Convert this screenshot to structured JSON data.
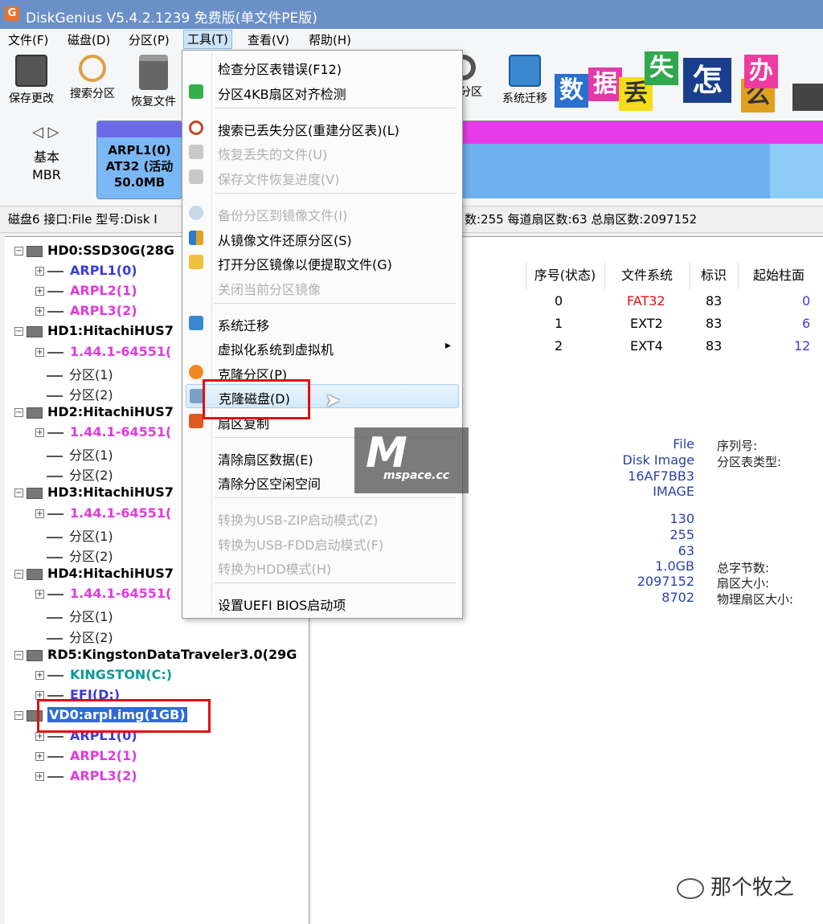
{
  "window": {
    "title": "DiskGenius V5.4.2.1239 免费版(单文件PE版)",
    "icon_text": "G"
  },
  "menubar": [
    {
      "label": "文件(F)"
    },
    {
      "label": "磁盘(D)"
    },
    {
      "label": "分区(P)"
    },
    {
      "label": "工具(T)"
    },
    {
      "label": "查看(V)"
    },
    {
      "label": "帮助(H)"
    }
  ],
  "toolbar": [
    {
      "label": "保存更改",
      "icon": "save-icon"
    },
    {
      "label": "搜索分区",
      "icon": "search-icon"
    },
    {
      "label": "恢复文件",
      "icon": "recover-icon"
    },
    {
      "label": "分区",
      "icon": "partition-icon"
    },
    {
      "label": "系统迁移",
      "icon": "migrate-icon"
    }
  ],
  "banner": {
    "chars": [
      "数",
      "据",
      "丢",
      "失",
      "怎",
      "么",
      "办"
    ]
  },
  "disk_strip": {
    "nav": "◁ ▷",
    "type_line1": "基本",
    "type_line2": "MBR",
    "part1_name": "ARPL1(0)",
    "part1_fs": "AT32 (活动 ",
    "part1_size": "50.0MB"
  },
  "info_line": {
    "left": "磁盘6 接口:File  型号:Disk I",
    "right": "数:255  每道扇区数:63  总扇区数:2097152"
  },
  "tree": [
    {
      "label": "HD0:SSD30G(28G",
      "kind": "disk"
    },
    {
      "label": "ARPL1(0)",
      "kind": "part",
      "color": "blue"
    },
    {
      "label": "ARPL2(1)",
      "kind": "part",
      "color": "pink"
    },
    {
      "label": "ARPL3(2)",
      "kind": "part",
      "color": "pink"
    },
    {
      "label": "HD1:HitachiHUS7",
      "kind": "disk"
    },
    {
      "label": "1.44.1-64551(",
      "kind": "part",
      "color": "pink"
    },
    {
      "label": "分区(1)",
      "kind": "sub"
    },
    {
      "label": "分区(2)",
      "kind": "sub"
    },
    {
      "label": "HD2:HitachiHUS7",
      "kind": "disk"
    },
    {
      "label": "1.44.1-64551(",
      "kind": "part",
      "color": "pink"
    },
    {
      "label": "分区(1)",
      "kind": "sub"
    },
    {
      "label": "分区(2)",
      "kind": "sub"
    },
    {
      "label": "HD3:HitachiHUS7",
      "kind": "disk"
    },
    {
      "label": "1.44.1-64551(",
      "kind": "part",
      "color": "pink"
    },
    {
      "label": "分区(1)",
      "kind": "sub"
    },
    {
      "label": "分区(2)",
      "kind": "sub"
    },
    {
      "label": "HD4:HitachiHUS7",
      "kind": "disk"
    },
    {
      "label": "1.44.1-64551(",
      "kind": "part",
      "color": "pink"
    },
    {
      "label": "分区(1)",
      "kind": "sub"
    },
    {
      "label": "分区(2)",
      "kind": "sub"
    },
    {
      "label": "RD5:KingstonDataTraveler3.0(29G",
      "kind": "disk"
    },
    {
      "label": "KINGSTON(C:)",
      "kind": "part",
      "color": "teal"
    },
    {
      "label": "EFI(D:)",
      "kind": "part",
      "color": "blue"
    },
    {
      "label": "VD0:arpl.img(1GB)",
      "kind": "disk-selected"
    },
    {
      "label": "ARPL1(0)",
      "kind": "part",
      "color": "blue"
    },
    {
      "label": "ARPL2(1)",
      "kind": "part",
      "color": "pink"
    },
    {
      "label": "ARPL3(2)",
      "kind": "part",
      "color": "pink"
    }
  ],
  "table": {
    "headers": [
      "序号(状态)",
      "文件系统",
      "标识",
      "起始柱面"
    ],
    "rows": [
      {
        "index": "0",
        "fs": "FAT32",
        "id": "83",
        "cyl": "0"
      },
      {
        "index": "1",
        "fs": "EXT2",
        "id": "83",
        "cyl": "6"
      },
      {
        "index": "2",
        "fs": "EXT4",
        "id": "83",
        "cyl": "12"
      }
    ]
  },
  "disk_info": {
    "vals_a": [
      "File",
      "Disk Image",
      "16AF7BB3",
      "IMAGE"
    ],
    "labels_a": [
      "序列号:",
      "分区表类型:"
    ],
    "vals_b": [
      "130",
      "255",
      "63",
      "1.0GB",
      "2097152",
      "8702"
    ],
    "labels_b": [
      "总字节数:",
      "扇区大小:",
      "物理扇区大小:"
    ]
  },
  "tools_menu": [
    {
      "label": "检查分区表错误(F12)",
      "enabled": true
    },
    {
      "label": "分区4KB扇区对齐检测",
      "enabled": true,
      "icon": "align-icon"
    },
    {
      "sep": true
    },
    {
      "label": "搜索已丢失分区(重建分区表)(L)",
      "enabled": true,
      "icon": "search-icon"
    },
    {
      "label": "恢复丢失的文件(U)",
      "enabled": false,
      "icon": "recover-icon"
    },
    {
      "label": "保存文件恢复进度(V)",
      "enabled": false,
      "icon": "save-icon"
    },
    {
      "sep": true
    },
    {
      "label": "备份分区到镜像文件(I)",
      "enabled": false,
      "icon": "backup-icon"
    },
    {
      "label": "从镜像文件还原分区(S)",
      "enabled": true,
      "icon": "restore-icon"
    },
    {
      "label": "打开分区镜像以便提取文件(G)",
      "enabled": true,
      "icon": "folder-icon"
    },
    {
      "label": "关闭当前分区镜像",
      "enabled": false
    },
    {
      "sep": true
    },
    {
      "label": "系统迁移",
      "enabled": true,
      "icon": "migrate-icon"
    },
    {
      "label": "虚拟化系统到虚拟机",
      "enabled": true,
      "submenu": true
    },
    {
      "label": "克隆分区(P)",
      "enabled": true,
      "icon": "clone-partition-icon"
    },
    {
      "label": "克隆磁盘(D)",
      "enabled": true,
      "icon": "clone-disk-icon",
      "highlighted": true
    },
    {
      "label": "扇区复制",
      "enabled": true,
      "icon": "sector-copy-icon"
    },
    {
      "sep": true
    },
    {
      "label": "清除扇区数据(E)",
      "enabled": true
    },
    {
      "label": "清除分区空闲空间",
      "enabled": true
    },
    {
      "sep": true
    },
    {
      "label": "转换为USB-ZIP启动模式(Z)",
      "enabled": false
    },
    {
      "label": "转换为USB-FDD启动模式(F)",
      "enabled": false
    },
    {
      "label": "转换为HDD模式(H)",
      "enabled": false
    },
    {
      "sep": true
    },
    {
      "label": "设置UEFI BIOS启动项",
      "enabled": true
    }
  ],
  "watermark": {
    "big": "M",
    "small": "mspace.cc"
  },
  "wechat": {
    "name": "那个牧之"
  },
  "colors": {
    "accent": "#3a3ae0",
    "pink": "#e03ae0",
    "teal": "#0a9a9a",
    "fat32": "#e01010",
    "highlight_box": "#e01010"
  }
}
